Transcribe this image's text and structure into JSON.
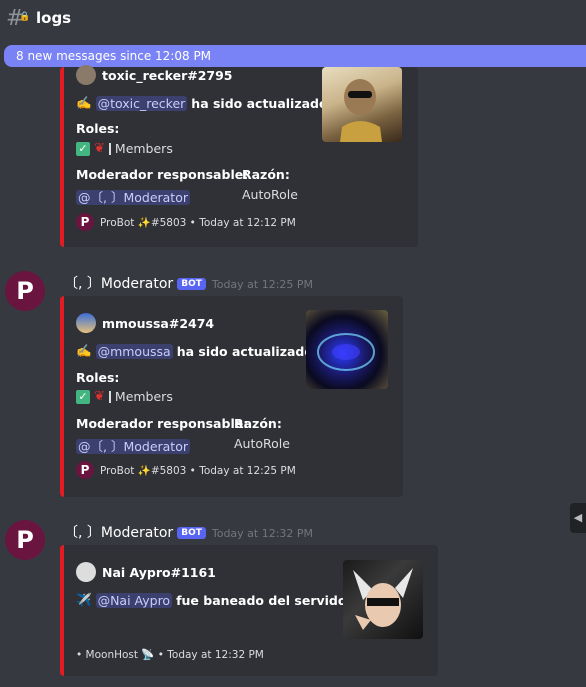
{
  "channel": {
    "name": "logs"
  },
  "new_messages_bar": "8 new messages since 12:08 PM",
  "messages": [
    {
      "embed": {
        "author": "toxic_recker#2795",
        "update_mention": "@toxic_recker",
        "update_text": "ha sido actualizado.",
        "roles_label": "Roles:",
        "roles_value": "Members",
        "mod_label": "Moderador responsable:",
        "mod_value": "@〔, 〕Moderator",
        "reason_label": "Razón:",
        "reason_value": "AutoRole",
        "footer": "ProBot ✨#5803 • Today at 12:12 PM"
      }
    },
    {
      "username": "〔, 〕Moderator",
      "bot_tag": "BOT",
      "timestamp": "Today at 12:25 PM",
      "embed": {
        "author": "mmoussa#2474",
        "update_mention": "@mmoussa",
        "update_text": "ha sido actualizado.",
        "roles_label": "Roles:",
        "roles_value": "Members",
        "mod_label": "Moderador responsable:",
        "mod_value": "@〔, 〕Moderator",
        "reason_label": "Razón:",
        "reason_value": "AutoRole",
        "footer": "ProBot ✨#5803 • Today at 12:25 PM"
      }
    },
    {
      "username": "〔, 〕Moderator",
      "bot_tag": "BOT",
      "timestamp": "Today at 12:32 PM",
      "embed": {
        "author": "Nai Aypro#1161",
        "ban_mention": "@Nai Aypro",
        "ban_text": "fue baneado del servidor.",
        "footer": "• MoonHost 📡 • Today at 12:32 PM"
      }
    }
  ]
}
